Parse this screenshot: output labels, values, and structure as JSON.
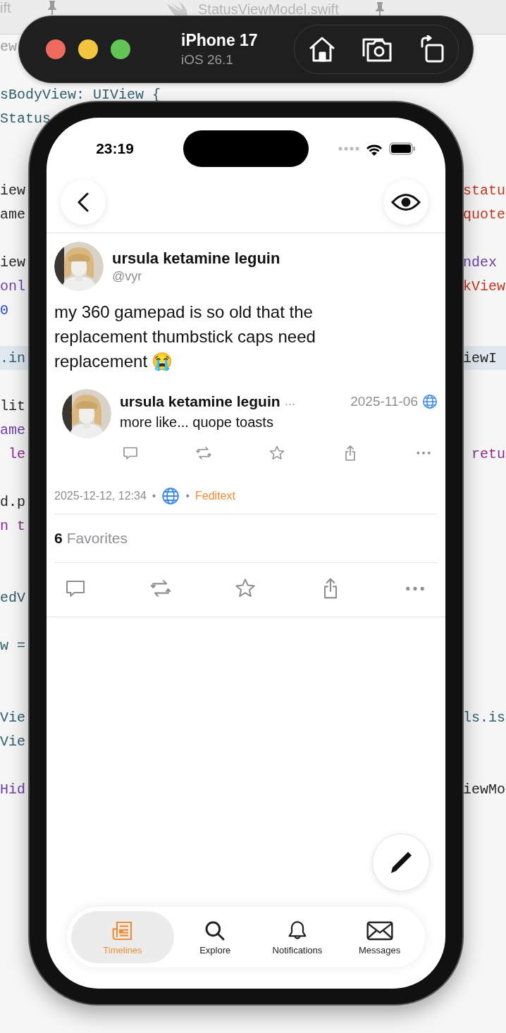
{
  "editor": {
    "tabs": [
      {
        "label": "ift",
        "selected": false
      },
      {
        "label": "StatusViewModel.swift",
        "selected": false
      }
    ],
    "lines": [
      {
        "left": {
          "text": "ew",
          "color": "#9a9a9a"
        },
        "highlighted": false
      },
      {
        "highlighted": false
      },
      {
        "left": {
          "text": "sBodyView: UIView {",
          "color": "#2f5f6e"
        },
        "highlighted": false
      },
      {
        "left": {
          "text": "Status",
          "color": "#2f5f6e"
        },
        "highlighted": false
      },
      {
        "highlighted": false
      },
      {
        "highlighted": false
      },
      {
        "left": {
          "text": "iew",
          "color": "#262626"
        },
        "right": {
          "text": "statu",
          "color": "#c2361f"
        },
        "highlighted": false
      },
      {
        "left": {
          "text": "ame",
          "color": "#262626"
        },
        "right": {
          "text": "quote",
          "color": "#c2361f"
        },
        "highlighted": false
      },
      {
        "highlighted": false
      },
      {
        "left": {
          "text": "iew",
          "color": "#262626"
        },
        "right": {
          "text": "ndex",
          "color": "#6c3fa8"
        },
        "highlighted": false
      },
      {
        "left": {
          "text": "onl",
          "color": "#6c3fa8"
        },
        "right": {
          "text": "kView",
          "color": "#c2361f"
        },
        "highlighted": false
      },
      {
        "left": {
          "text": "0",
          "color": "#1c3fd4"
        },
        "highlighted": false
      },
      {
        "highlighted": false
      },
      {
        "left": {
          "text": ".in",
          "color": "#2f5f6e"
        },
        "right": {
          "text": "iewI",
          "color": "#262626"
        },
        "highlighted": true
      },
      {
        "highlighted": false
      },
      {
        "left": {
          "text": "lit",
          "color": "#262626"
        },
        "highlighted": false
      },
      {
        "left": {
          "text": "ame",
          "color": "#6c3fa8"
        },
        "highlighted": false
      },
      {
        "left": {
          "text": " le",
          "color": "#8e2a8e"
        },
        "right": {
          "text": " retu",
          "color": "#8e2a8e"
        },
        "highlighted": false
      },
      {
        "highlighted": false
      },
      {
        "left": {
          "text": "d.p",
          "color": "#262626"
        },
        "highlighted": false
      },
      {
        "left": {
          "text": "n t",
          "color": "#8e2a8e"
        },
        "highlighted": false
      },
      {
        "highlighted": false
      },
      {
        "highlighted": false
      },
      {
        "left": {
          "text": "edV",
          "color": "#2f5f6e"
        },
        "highlighted": false
      },
      {
        "highlighted": false
      },
      {
        "left": {
          "text": "w =",
          "color": "#2f5f6e"
        },
        "highlighted": false
      },
      {
        "highlighted": false
      },
      {
        "highlighted": false
      },
      {
        "left": {
          "text": "Vie",
          "color": "#2f5f6e"
        },
        "right": {
          "text": "ls.is",
          "color": "#2f5f6e"
        },
        "highlighted": false
      },
      {
        "left": {
          "text": "Vie",
          "color": "#2f5f6e"
        },
        "highlighted": false
      },
      {
        "highlighted": false
      },
      {
        "left": {
          "text": "Hid",
          "color": "#6c3fa8"
        },
        "right": {
          "text": "iewMo",
          "color": "#262626"
        },
        "highlighted": false
      }
    ]
  },
  "simulator": {
    "device": "iPhone 17",
    "os": "iOS 26.1"
  },
  "phone": {
    "status_bar": {
      "time": "23:19"
    },
    "post": {
      "author": {
        "name": "ursula ketamine leguin",
        "handle": "@vyr"
      },
      "body": "my 360 gamepad is so old that the replacement thumbstick caps need replacement 😭",
      "quote": {
        "name": "ursula ketamine leguin",
        "overflow_mark": "…",
        "date": "2025-11-06",
        "text": "more like... quope toasts"
      },
      "meta": {
        "timestamp": "2025-12-12, 12:34",
        "separators": [
          "•",
          "•"
        ],
        "client": "Feditext"
      },
      "favorites": {
        "count": "6",
        "label": "Favorites"
      }
    },
    "tab_bar": [
      {
        "label": "Timelines",
        "selected": true
      },
      {
        "label": "Explore",
        "selected": false
      },
      {
        "label": "Notifications",
        "selected": false
      },
      {
        "label": "Messages",
        "selected": false
      }
    ]
  }
}
